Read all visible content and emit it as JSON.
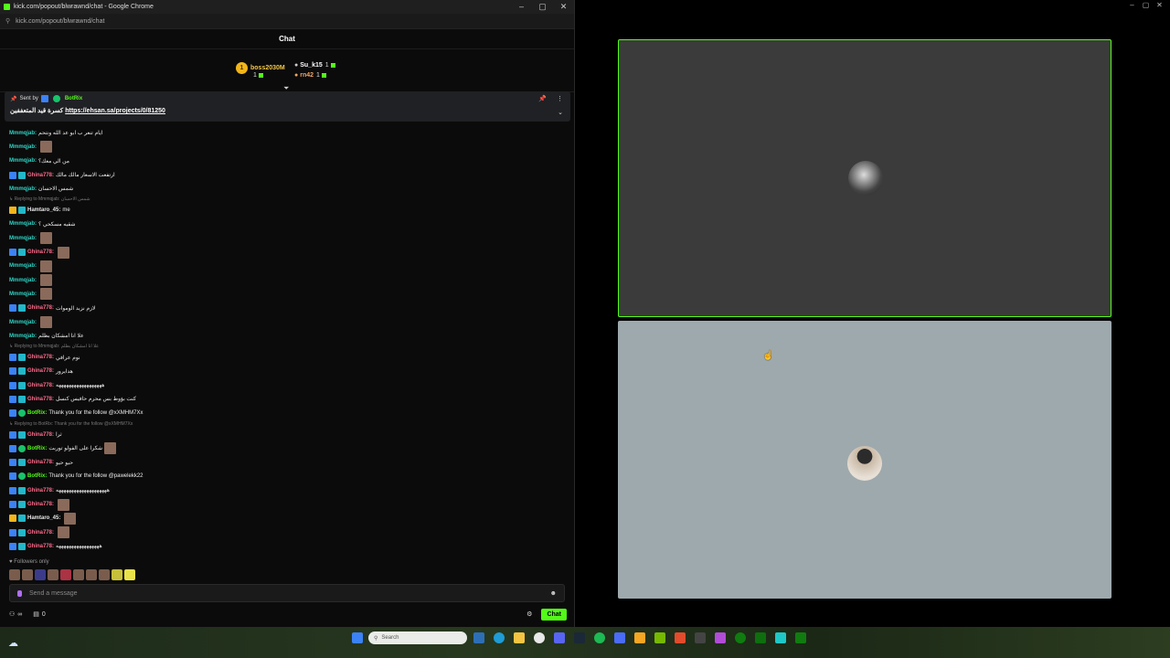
{
  "window": {
    "title": "kick.com/popout/blwrawnd/chat - Google Chrome",
    "url": "kick.com/popout/blwrawnd/chat"
  },
  "chat": {
    "header": "Chat",
    "gifters": [
      {
        "name": "boss2030M",
        "count": "1",
        "rank": "1"
      },
      {
        "name": "Su_k15",
        "count": "1"
      },
      {
        "name": "rn42",
        "count": "1"
      }
    ],
    "pinned": {
      "sent_by_label": "Sent by",
      "sender": "BotRix",
      "text": "كسرة قيد المتعففين",
      "link": "https://ehsan.sa/projects/0/81250"
    },
    "messages": [
      {
        "user": "Mmmqjab",
        "text": "ايام تنعر ب ابو عد الله ونتحم",
        "color": "teal",
        "badges": []
      },
      {
        "user": "Mmmqjab",
        "text": "",
        "color": "teal",
        "badges": [],
        "emote": true
      },
      {
        "user": "Mmmqjab",
        "text": "من الي معك؟",
        "color": "teal",
        "badges": []
      },
      {
        "user": "Ghina778",
        "text": "ارتفعت الاسعار مالك مالك",
        "color": "pink",
        "badges": [
          "blue",
          "teal"
        ]
      },
      {
        "user": "Mmmqjab",
        "text": "شمس الاحسان",
        "color": "teal",
        "badges": []
      },
      {
        "reply": "Replying to Mmmqjab: شمس الاحسان"
      },
      {
        "user": "Hamtaro_45",
        "text": "me",
        "color": "white",
        "badges": [
          "gold",
          "teal"
        ]
      },
      {
        "user": "Mmmqjab",
        "text": "شقيه مسكحي ؟",
        "color": "teal",
        "badges": []
      },
      {
        "user": "Mmmqjab",
        "text": "",
        "color": "teal",
        "badges": [],
        "emote": true
      },
      {
        "user": "Ghina778",
        "text": "",
        "color": "pink",
        "badges": [
          "blue",
          "teal"
        ],
        "emote": true
      },
      {
        "user": "Mmmqjab",
        "text": "",
        "color": "teal",
        "badges": [],
        "emote": true
      },
      {
        "user": "Mmmqjab",
        "text": "",
        "color": "teal",
        "badges": [],
        "emote": true
      },
      {
        "user": "Mmmqjab",
        "text": "",
        "color": "teal",
        "badges": [],
        "emote": true
      },
      {
        "user": "Ghina778",
        "text": "لازم نزيد الوموات",
        "color": "pink",
        "badges": [
          "blue",
          "teal"
        ]
      },
      {
        "user": "Mmmqjab",
        "text": "",
        "color": "teal",
        "badges": [],
        "emote": true
      },
      {
        "user": "Mmmqjab",
        "text": "علا انا امشكان بظلم",
        "color": "teal",
        "badges": []
      },
      {
        "reply": "Replying to Mmmqjab: علا انا امشكان بظلم"
      },
      {
        "user": "Ghina778",
        "text": "نوم عرافي",
        "color": "pink",
        "badges": [
          "blue",
          "teal"
        ]
      },
      {
        "user": "Ghina778",
        "text": "هدايرور",
        "color": "pink",
        "badges": [
          "blue",
          "teal"
        ]
      },
      {
        "user": "Ghina778",
        "text": "ههههههههههههههههههه",
        "color": "pink",
        "badges": [
          "blue",
          "teal"
        ]
      },
      {
        "user": "Ghina778",
        "text": "كنت بؤوط بس محرم حافيس كنسل",
        "color": "pink",
        "badges": [
          "blue",
          "teal"
        ]
      },
      {
        "user": "BotRix",
        "text": "Thank you for the follow @xXMHM7Xx",
        "color": "lime",
        "badges": [
          "blue",
          "green"
        ]
      },
      {
        "reply": "Replying to BotRix: Thank you for the follow @xXMHM7Xx"
      },
      {
        "user": "Ghina778",
        "text": "ثرا",
        "color": "pink",
        "badges": [
          "blue",
          "teal"
        ]
      },
      {
        "user": "BotRix",
        "text": "شكرا على الفولو توربت",
        "color": "lime",
        "badges": [
          "blue",
          "green"
        ],
        "emote": true
      },
      {
        "user": "Ghina778",
        "text": "حيو حيو",
        "color": "pink",
        "badges": [
          "blue",
          "teal"
        ]
      },
      {
        "user": "BotRix",
        "text": "Thank you for the follow @pawelekk22",
        "color": "lime",
        "badges": [
          "blue",
          "green"
        ]
      },
      {
        "user": "Ghina778",
        "text": "ههههههههههههههههههههه",
        "color": "pink",
        "badges": [
          "blue",
          "teal"
        ]
      },
      {
        "user": "Ghina778",
        "text": "",
        "color": "pink",
        "badges": [
          "blue",
          "teal"
        ],
        "emote": true
      },
      {
        "user": "Hamtaro_45",
        "text": "",
        "color": "white",
        "badges": [
          "gold",
          "teal"
        ],
        "emote": true
      },
      {
        "user": "Ghina778",
        "text": "",
        "color": "pink",
        "badges": [
          "blue",
          "teal"
        ],
        "emote": true
      },
      {
        "user": "Ghina778",
        "text": "هههههههههههههههههه",
        "color": "pink",
        "badges": [
          "blue",
          "teal"
        ]
      }
    ],
    "followers_only": "Followers only",
    "input_placeholder": "Send a message",
    "viewer_count": "∞",
    "gift_count": "0",
    "send_label": "Chat"
  },
  "taskbar": {
    "search_placeholder": "Search"
  }
}
